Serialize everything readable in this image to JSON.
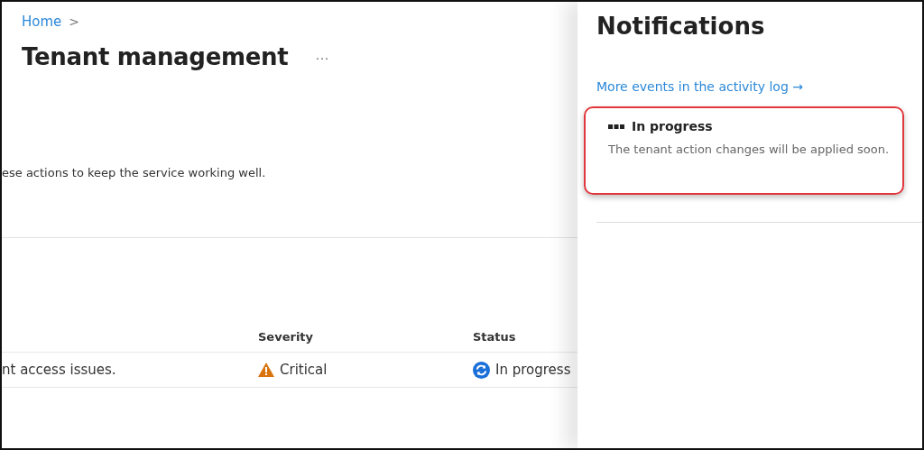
{
  "breadcrumb": {
    "label": "Home",
    "separator": ">"
  },
  "page": {
    "title": "Tenant management",
    "more": "···",
    "description": "ese actions to keep the service working well."
  },
  "table": {
    "columns": [
      "",
      "Severity",
      "Status"
    ],
    "rows": [
      {
        "description": "nt access issues.",
        "severity": {
          "kind": "warning",
          "label": "Critical"
        },
        "status": {
          "kind": "sync",
          "label": "In progress"
        }
      }
    ]
  },
  "notifications": {
    "title": "Notifications",
    "link": "More events in the activity log →",
    "items": [
      {
        "kind": "progress",
        "title": "In progress",
        "message": "The tenant action changes will be applied soon.",
        "highlighted": true
      }
    ]
  }
}
